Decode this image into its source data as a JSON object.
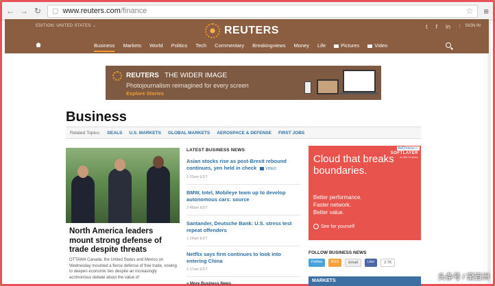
{
  "browser": {
    "url_host": "www.reuters.com",
    "url_path": "/finance"
  },
  "header": {
    "edition": "EDITION: UNITED STATES",
    "edition_chevron": "⌄",
    "brand": "REUTERS",
    "sign_in": "SIGN IN",
    "social_icons": [
      "twitter-icon",
      "facebook-icon",
      "linkedin-icon"
    ],
    "social_glyphs": [
      "t",
      "f",
      "in"
    ]
  },
  "nav": {
    "items": [
      "Business",
      "Markets",
      "World",
      "Politics",
      "Tech",
      "Commentary",
      "Breakingviews",
      "Money",
      "Life"
    ],
    "active": "Business",
    "pictures": "Pictures",
    "video": "Video"
  },
  "banner": {
    "brand": "REUTERS",
    "title": "THE WIDER IMAGE",
    "tagline": "Photojournalism reimagined for every screen",
    "cta": "Explore Stories"
  },
  "page": {
    "title": "Business",
    "related_label": "Related Topics:",
    "related_topics": [
      "DEALS",
      "U.S. MARKETS",
      "GLOBAL MARKETS",
      "AEROSPACE & DEFENSE",
      "FIRST JOBS"
    ]
  },
  "hero": {
    "title": "North America leaders mount strong defense of trade despite threats",
    "body": "OTTAWA Canada, the United States and Mexico on Wednesday mounted a fierce defense of free trade, vowing to deepen economic ties despite an increasingly acrimonious debate about the value of"
  },
  "latest": {
    "heading": "LATEST BUSINESS NEWS",
    "video_label": "VIDEO",
    "stories": [
      {
        "title": "Asian stocks rise as post-Brexit rebound continues, yen held in check",
        "time": "1:03am EDT"
      },
      {
        "title": "BMW, Intel, Mobileye team up to develop autonomous cars: source",
        "time": "2:48am EDT"
      },
      {
        "title": "Santander, Deutsche Bank: U.S. stress test repeat offenders",
        "time": "1:24am EDT"
      },
      {
        "title": "Netflix says firm continues to look into entering China",
        "time": "1:17am EDT"
      }
    ],
    "more": "» More Business News"
  },
  "ad": {
    "adchoices": "AdChoices ▷",
    "brand": "SOFTLAYER",
    "brand_sub": "an IBM Company",
    "headline": "Cloud that breaks boundaries.",
    "lines": [
      "Better performance.",
      "Faster network.",
      "Better value."
    ],
    "cta": "See for yourself"
  },
  "follow": {
    "heading": "FOLLOW BUSINESS NEWS",
    "twitter": "Follow",
    "rss": "RSS",
    "email": "Email",
    "facebook": "Like",
    "fb_count": "2.7K"
  },
  "markets_bar": "MARKETS",
  "watermark": "头条号 / 聚百洲"
}
